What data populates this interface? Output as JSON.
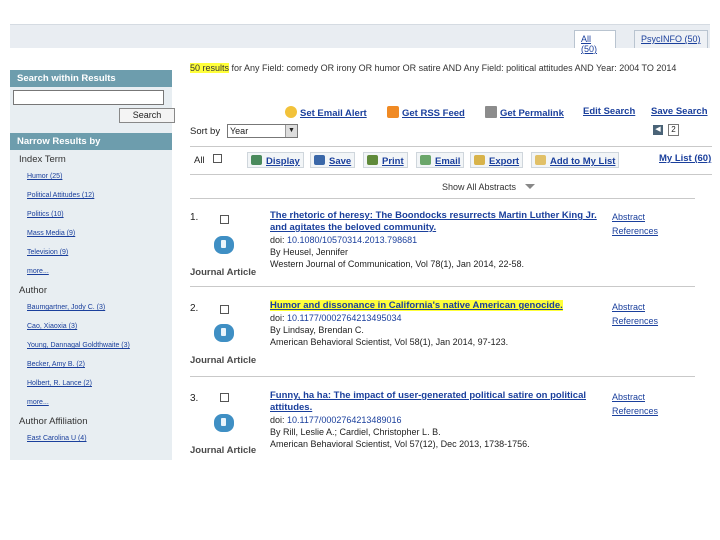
{
  "tabs": [
    {
      "label": "All (50)"
    },
    {
      "label": "PsycINFO (50)"
    }
  ],
  "sidebar": {
    "search_header": "Search within Results",
    "search_button": "Search",
    "narrow_header": "Narrow Results by",
    "groups": [
      {
        "title": "Index Term",
        "items": [
          "Humor (25)",
          "Political Attitudes (12)",
          "Politics (10)",
          "Mass Media (9)",
          "Television (9)",
          "more..."
        ]
      },
      {
        "title": "Author",
        "items": [
          "Baumgartner, Jody C. (3)",
          "Cao, Xiaoxia (3)",
          "Young, Dannagal Goldthwaite (3)",
          "Becker, Amy B. (2)",
          "Holbert, R. Lance (2)",
          "more..."
        ]
      },
      {
        "title": "Author Affiliation",
        "items": [
          "East Carolina U (4)"
        ]
      }
    ]
  },
  "summary": {
    "prefix": "50 results",
    "text": " for Any Field: comedy OR irony OR humor OR satire AND Any Field: political attitudes AND Year: 2004 TO 2014"
  },
  "actions": [
    "Set Email Alert",
    "Get RSS Feed",
    "Get Permalink",
    "Edit Search",
    "Save Search"
  ],
  "sort": {
    "label": "Sort by",
    "value": "Year",
    "page": "2"
  },
  "toolbar": {
    "all": "All",
    "buttons": [
      "Display",
      "Save",
      "Print",
      "Email",
      "Export",
      "Add to My List"
    ],
    "mylist": "My List (60)"
  },
  "show_abstracts": "Show All Abstracts",
  "results": [
    {
      "num": "1.",
      "title": "The rhetoric of heresy: The Boondocks resurrects Martin Luther King Jr. and agitates the beloved community.",
      "doi_label": "doi: ",
      "doi": "10.1080/10570314.2013.798681",
      "author": "By Heusel, Jennifer",
      "source": "Western Journal of Communication, Vol 78(1), Jan 2014, 22-58.",
      "type": "Journal Article",
      "abstract": "Abstract",
      "refs": "References"
    },
    {
      "num": "2.",
      "title": "Humor and dissonance in California's native American genocide.",
      "doi_label": "doi: ",
      "doi": "10.1177/0002764213495034",
      "author": "By Lindsay, Brendan C.",
      "source": "American Behavioral Scientist, Vol 58(1), Jan 2014, 97-123.",
      "type": "Journal Article",
      "abstract": "Abstract",
      "refs": "References"
    },
    {
      "num": "3.",
      "title": "Funny, ha ha: The impact of user-generated political satire on political attitudes.",
      "doi_label": "doi: ",
      "doi": "10.1177/0002764213489016",
      "author": "By Rill, Leslie A.; Cardiel, Christopher L. B.",
      "source": "American Behavioral Scientist, Vol 57(12), Dec 2013, 1738-1756.",
      "type": "Journal Article",
      "abstract": "Abstract",
      "refs": "References"
    }
  ],
  "colors": {
    "sidebar_header": "#6d9dad",
    "sidebar_bg": "#e8eef2",
    "link": "#1a3f9c",
    "highlight": "#ffff3a"
  }
}
